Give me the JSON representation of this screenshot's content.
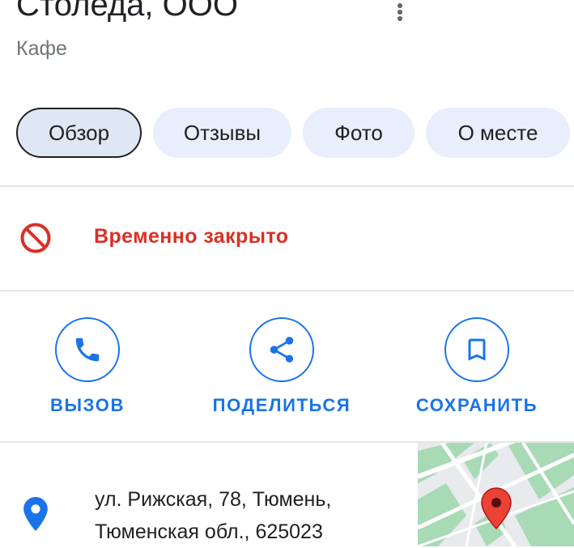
{
  "header": {
    "title": "Столеда, ООО",
    "category": "Кафе",
    "more_icon": "more-vert-icon"
  },
  "tabs": [
    {
      "label": "Обзор",
      "active": true
    },
    {
      "label": "Отзывы",
      "active": false
    },
    {
      "label": "Фото",
      "active": false
    },
    {
      "label": "О месте",
      "active": false
    }
  ],
  "status": {
    "icon": "block-icon",
    "text": "Временно закрыто",
    "color": "#d93025"
  },
  "actions": [
    {
      "label": "ВЫЗОВ",
      "icon": "phone-icon"
    },
    {
      "label": "ПОДЕЛИТЬСЯ",
      "icon": "share-icon"
    },
    {
      "label": "СОХРАНИТЬ",
      "icon": "bookmark-icon"
    }
  ],
  "address": {
    "icon": "location-pin-icon",
    "line1": "ул. Рижская, 78, Тюмень,",
    "line2": "Тюменская обл., 625023"
  },
  "map": {
    "marker_icon": "map-marker-icon"
  },
  "colors": {
    "accent": "#1a73e8",
    "closed": "#d93025",
    "tab_bg": "#e8eefb"
  }
}
